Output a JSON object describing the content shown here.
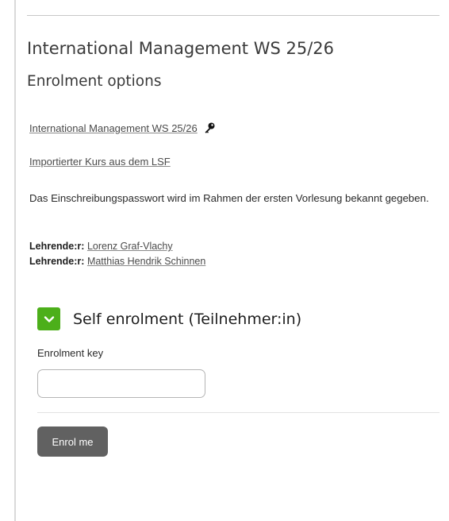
{
  "course": {
    "title": "International Management WS 25/26",
    "section_title": "Enrolment options",
    "link_label": "International Management WS 25/26",
    "imported_label": "Importierter Kurs aus dem LSF",
    "info_text": "Das Einschreibungspasswort wird im Rahmen der ersten Vorlesung bekannt gegeben."
  },
  "teachers": [
    {
      "role": "Lehrende:r:",
      "name": "Lorenz Graf-Vlachy"
    },
    {
      "role": "Lehrende:r:",
      "name": "Matthias Hendrik Schinnen"
    }
  ],
  "enrolment": {
    "title": "Self enrolment (Teilnehmer:in)",
    "key_label": "Enrolment key",
    "key_value": "",
    "button_label": "Enrol me"
  },
  "icons": {
    "key": "key-icon",
    "expand": "chevron-down-icon"
  },
  "colors": {
    "accent": "#4caf1a",
    "button": "#616161"
  }
}
